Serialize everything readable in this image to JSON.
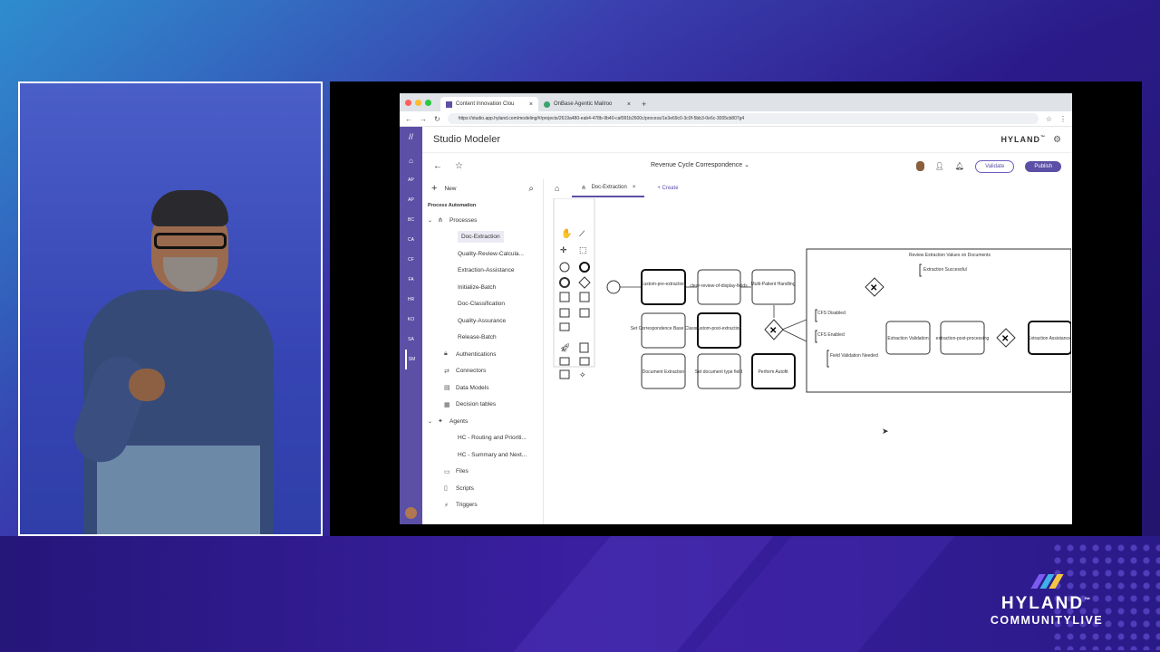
{
  "browser": {
    "tabs": [
      {
        "label": "Content Innovation Clou",
        "active": true
      },
      {
        "label": "OnBase Agentic Mailroo",
        "active": false
      }
    ],
    "url": "https://studio.app.hyland.com/modeling/#/projects/2619a480-eab4-478b-9b40-caf991b2600c/process/1e3e69c0-3c0f-5bb3-0e6c-3005cb807g4"
  },
  "app": {
    "title": "Studio Modeler",
    "brand": "HYLAND",
    "brand_tm": "™",
    "process_name": "Revenue Cycle Correspondence",
    "validate_label": "Validate",
    "publish_label": "Publish",
    "rail_items": [
      "AP",
      "AP",
      "BC",
      "CA",
      "CF",
      "FA",
      "HR",
      "KO",
      "SA",
      "SM"
    ]
  },
  "tree": {
    "new_label": "New",
    "section": "Process Automation",
    "items": [
      {
        "label": "Processes",
        "icon": "process-icon",
        "level": 1,
        "expanded": true
      },
      {
        "label": "Doc-Extraction",
        "level": 2,
        "selected": true
      },
      {
        "label": "Quality-Review-Calcula...",
        "level": 2
      },
      {
        "label": "Extraction-Assistance",
        "level": 2
      },
      {
        "label": "Initialize-Batch",
        "level": 2
      },
      {
        "label": "Doc-Classification",
        "level": 2
      },
      {
        "label": "Quality-Assurance",
        "level": 2
      },
      {
        "label": "Release-Batch",
        "level": 2
      },
      {
        "label": "Authentications",
        "icon": "lock-icon",
        "level": 1
      },
      {
        "label": "Connectors",
        "icon": "connector-icon",
        "level": 1
      },
      {
        "label": "Data Models",
        "icon": "database-icon",
        "level": 1
      },
      {
        "label": "Decision tables",
        "icon": "table-icon",
        "level": 1
      },
      {
        "label": "Agents",
        "icon": "agent-icon",
        "level": 1,
        "expanded": true
      },
      {
        "label": "HC - Routing and Prioriti...",
        "level": 2
      },
      {
        "label": "HC - Summary and Next...",
        "level": 2
      },
      {
        "label": "Files",
        "icon": "folder-icon",
        "level": 1
      },
      {
        "label": "Scripts",
        "icon": "script-icon",
        "level": 1
      },
      {
        "label": "Triggers",
        "icon": "trigger-icon",
        "level": 1
      }
    ]
  },
  "canvas": {
    "tab_label": "Doc-Extraction",
    "create_label": "Create",
    "tasks": {
      "custom_pre": "custom-pre-extraction",
      "clear_review": "clear-review-of-display-fields",
      "multi_patient": "Multi-Patient Handling",
      "set_corr": "Set Correspondence Base Class",
      "custom_post": "custom-post-extraction",
      "doc_extraction": "Document Extraction",
      "set_doc_type": "Set document type field",
      "perform_autofit": "Perform Autofit",
      "extraction_validation": "Extraction Validation",
      "extraction_post": "extraction-post-processing",
      "extraction_assistance": "Extraction Assistance"
    },
    "subprocess_title": "Review Extraction Values on Documents",
    "labels": {
      "extraction_successful": "Extraction Successful",
      "cfs_disabled": "CFS Disabled",
      "cfs_enabled": "CFS Enabled",
      "field_validation": "Field Validation Needed"
    }
  },
  "event": {
    "brand": "HYLAND",
    "tm": "™",
    "name": "COMMUNITYLIVE",
    "colors": [
      "#7b5cf0",
      "#3fb0e8",
      "#f5c542"
    ]
  }
}
